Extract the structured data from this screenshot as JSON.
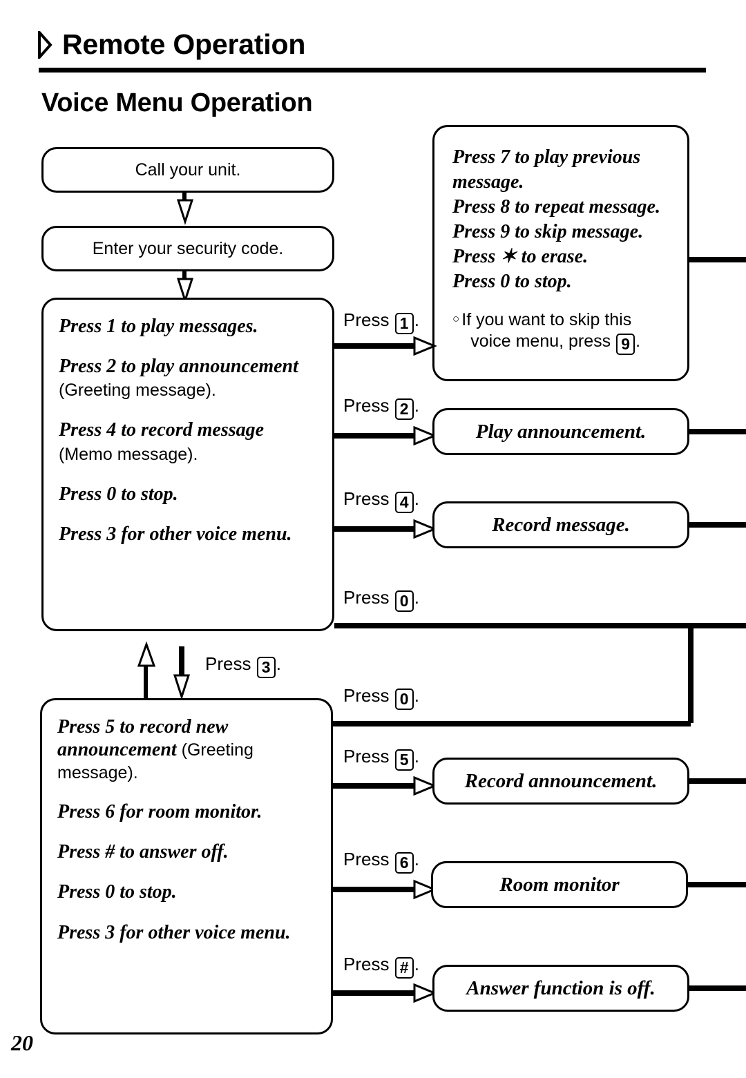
{
  "header": {
    "icon": "diamond-bullet-icon",
    "title": "Remote Operation",
    "subtitle": "Voice Menu Operation"
  },
  "flow": {
    "start_boxes": [
      {
        "id": "call-unit",
        "text": "Call your unit."
      },
      {
        "id": "security-code",
        "text": "Enter your security code."
      }
    ],
    "main_menu": {
      "lines": [
        {
          "italic": "Press 1 to play messages.",
          "plain": ""
        },
        {
          "italic": "Press 2 to play announcement",
          "plain": "(Greeting message)."
        },
        {
          "italic": "Press 4 to record message",
          "plain": "(Memo message)."
        },
        {
          "italic": "Press 0 to stop.",
          "plain": ""
        },
        {
          "italic": "Press 3 for other voice menu.",
          "plain": ""
        }
      ]
    },
    "other_menu": {
      "lines": [
        {
          "italic": "Press 5 to record new announcement",
          "plain": " (Greeting message)."
        },
        {
          "italic": "Press 6 for room monitor.",
          "plain": ""
        },
        {
          "italic": "Press # to answer off.",
          "plain": ""
        },
        {
          "italic": "Press 0 to stop.",
          "plain": ""
        },
        {
          "italic": "Press 3 for other voice menu.",
          "plain": ""
        }
      ]
    },
    "playback_box": {
      "commands": [
        "Press 7 to play previous",
        "message.",
        "Press 8 to repeat message.",
        "Press 9 to skip message.",
        "Press ✶ to erase.",
        "Press 0 to stop."
      ],
      "note_bullet": "○",
      "note_part1": "If you want to skip this",
      "note_part2": "voice menu, press",
      "note_key": "9",
      "note_end": "."
    },
    "result_boxes": [
      {
        "id": "play-announcement",
        "text": "Play announcement."
      },
      {
        "id": "record-message",
        "text": "Record message."
      },
      {
        "id": "record-announcement",
        "text": "Record announcement."
      },
      {
        "id": "room-monitor",
        "text": "Room monitor"
      },
      {
        "id": "answer-off",
        "text": "Answer function is off."
      }
    ],
    "connector_labels": [
      {
        "id": "press-1",
        "prefix": "Press",
        "key": "1",
        "suffix": "."
      },
      {
        "id": "press-2",
        "prefix": "Press",
        "key": "2",
        "suffix": "."
      },
      {
        "id": "press-4",
        "prefix": "Press",
        "key": "4",
        "suffix": "."
      },
      {
        "id": "press-0-upper",
        "prefix": "Press",
        "key": "0",
        "suffix": "."
      },
      {
        "id": "press-3",
        "prefix": "Press",
        "key": "3",
        "suffix": "."
      },
      {
        "id": "press-0-lower",
        "prefix": "Press",
        "key": "0",
        "suffix": "."
      },
      {
        "id": "press-5",
        "prefix": "Press",
        "key": "5",
        "suffix": "."
      },
      {
        "id": "press-6",
        "prefix": "Press",
        "key": "6",
        "suffix": "."
      },
      {
        "id": "press-hash",
        "prefix": "Press",
        "key": "#",
        "suffix": "."
      }
    ]
  },
  "footer": {
    "page_number": "20"
  }
}
